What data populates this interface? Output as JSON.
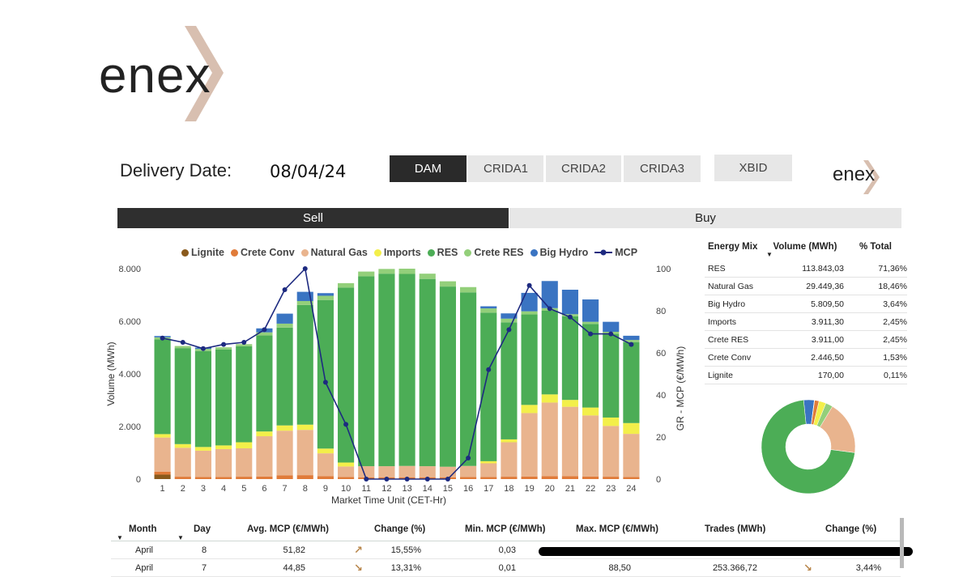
{
  "brand": {
    "logo_text": "enex",
    "small_logo_text": "enex",
    "accent_color": "#d5b9a8"
  },
  "header": {
    "delivery_label": "Delivery Date:",
    "delivery_date": "08/04/24"
  },
  "market_tabs": [
    {
      "label": "DAM",
      "active": true
    },
    {
      "label": "CRIDA1",
      "active": false
    },
    {
      "label": "CRIDA2",
      "active": false
    },
    {
      "label": "CRIDA3",
      "active": false
    },
    {
      "label": "XBID",
      "active": false
    }
  ],
  "side_tabs": [
    {
      "label": "Sell",
      "active": true
    },
    {
      "label": "Buy",
      "active": false
    }
  ],
  "chart_data": {
    "type": "bar",
    "stacked": true,
    "xlabel": "Market Time Unit (CET-Hr)",
    "ylabel": "Volume (MWh)",
    "y2label": "GR - MCP (€/MWh)",
    "ylim": [
      0,
      8000
    ],
    "y2lim": [
      0,
      100
    ],
    "yticks": [
      "0",
      "2.000",
      "4.000",
      "6.000",
      "8.000"
    ],
    "y2ticks": [
      "0",
      "20",
      "40",
      "60",
      "80",
      "100"
    ],
    "categories": [
      "1",
      "2",
      "3",
      "4",
      "5",
      "6",
      "7",
      "8",
      "9",
      "10",
      "11",
      "12",
      "13",
      "14",
      "15",
      "16",
      "17",
      "18",
      "19",
      "20",
      "21",
      "22",
      "23",
      "24"
    ],
    "series": [
      {
        "name": "Lignite",
        "color": "#8a5a1c",
        "values": [
          170,
          0,
          0,
          0,
          0,
          0,
          0,
          0,
          0,
          0,
          0,
          0,
          0,
          0,
          0,
          0,
          0,
          0,
          0,
          0,
          0,
          0,
          0,
          0
        ]
      },
      {
        "name": "Crete Conv",
        "color": "#e07b39",
        "values": [
          110,
          90,
          80,
          80,
          90,
          100,
          140,
          150,
          110,
          80,
          70,
          70,
          70,
          70,
          70,
          80,
          80,
          90,
          100,
          110,
          110,
          100,
          90,
          80
        ]
      },
      {
        "name": "Natural Gas",
        "color": "#e9b48e",
        "values": [
          1300,
          1100,
          1000,
          1060,
          1080,
          1530,
          1700,
          1720,
          870,
          400,
          420,
          420,
          430,
          420,
          400,
          420,
          520,
          1310,
          2410,
          2800,
          2640,
          2320,
          1930,
          1640
        ]
      },
      {
        "name": "Imports",
        "color": "#f3ef4a",
        "values": [
          130,
          140,
          140,
          140,
          230,
          180,
          200,
          200,
          180,
          150,
          0,
          0,
          0,
          0,
          0,
          0,
          80,
          110,
          310,
          310,
          260,
          300,
          320,
          410
        ]
      },
      {
        "name": "RES",
        "color": "#4cad56",
        "values": [
          3600,
          3650,
          3650,
          3650,
          3650,
          3650,
          3720,
          4550,
          5650,
          6650,
          7220,
          7320,
          7300,
          7120,
          6850,
          6600,
          5650,
          4450,
          3440,
          3180,
          3180,
          3180,
          3180,
          3080
        ]
      },
      {
        "name": "Crete RES",
        "color": "#93cf7a",
        "values": [
          80,
          80,
          80,
          80,
          80,
          120,
          150,
          150,
          160,
          170,
          180,
          180,
          200,
          200,
          200,
          200,
          160,
          140,
          120,
          100,
          80,
          80,
          80,
          80
        ]
      },
      {
        "name": "Big Hydro",
        "color": "#3a74c2",
        "values": [
          50,
          0,
          50,
          0,
          0,
          150,
          380,
          350,
          100,
          0,
          0,
          0,
          0,
          0,
          0,
          0,
          80,
          200,
          700,
          1030,
          930,
          850,
          380,
          160
        ]
      }
    ],
    "line": {
      "name": "MCP",
      "color": "#1d2a80",
      "values": [
        67,
        65,
        62,
        64,
        65,
        71,
        90,
        100,
        46,
        26,
        0,
        0,
        0,
        0,
        0,
        10,
        52,
        71,
        92,
        81,
        77,
        69,
        69,
        64
      ]
    }
  },
  "energy_mix": {
    "headers": [
      "Energy Mix",
      "Volume (MWh)",
      "% Total"
    ],
    "rows": [
      {
        "name": "RES",
        "volume": "113.843,03",
        "pct": "71,36%",
        "share": 71.36,
        "color": "#4cad56"
      },
      {
        "name": "Natural Gas",
        "volume": "29.449,36",
        "pct": "18,46%",
        "share": 18.46,
        "color": "#e9b48e"
      },
      {
        "name": "Big Hydro",
        "volume": "5.809,50",
        "pct": "3,64%",
        "share": 3.64,
        "color": "#3a74c2"
      },
      {
        "name": "Imports",
        "volume": "3.911,30",
        "pct": "2,45%",
        "share": 2.45,
        "color": "#f3ef4a"
      },
      {
        "name": "Crete RES",
        "volume": "3.911,00",
        "pct": "2,45%",
        "share": 2.45,
        "color": "#93cf7a"
      },
      {
        "name": "Crete Conv",
        "volume": "2.446,50",
        "pct": "1,53%",
        "share": 1.53,
        "color": "#e07b39"
      },
      {
        "name": "Lignite",
        "volume": "170,00",
        "pct": "0,11%",
        "share": 0.11,
        "color": "#8a5a1c"
      }
    ]
  },
  "trades_table": {
    "headers": [
      "Month",
      "Day",
      "Avg. MCP (€/MWh)",
      "Change (%)",
      "Min. MCP (€/MWh)",
      "Max. MCP (€/MWh)",
      "Trades (MWh)",
      "Change (%)"
    ],
    "rows": [
      {
        "month": "April",
        "day": "8",
        "avg": "51,82",
        "trend": "up",
        "change": "15,55%",
        "min": "0,03",
        "max": "",
        "trades": "",
        "change2": ""
      },
      {
        "month": "April",
        "day": "7",
        "avg": "44,85",
        "trend": "down",
        "change": "13,31%",
        "min": "0,01",
        "max": "88,50",
        "trades": "253.366,72",
        "change2": "3,44%"
      }
    ]
  }
}
